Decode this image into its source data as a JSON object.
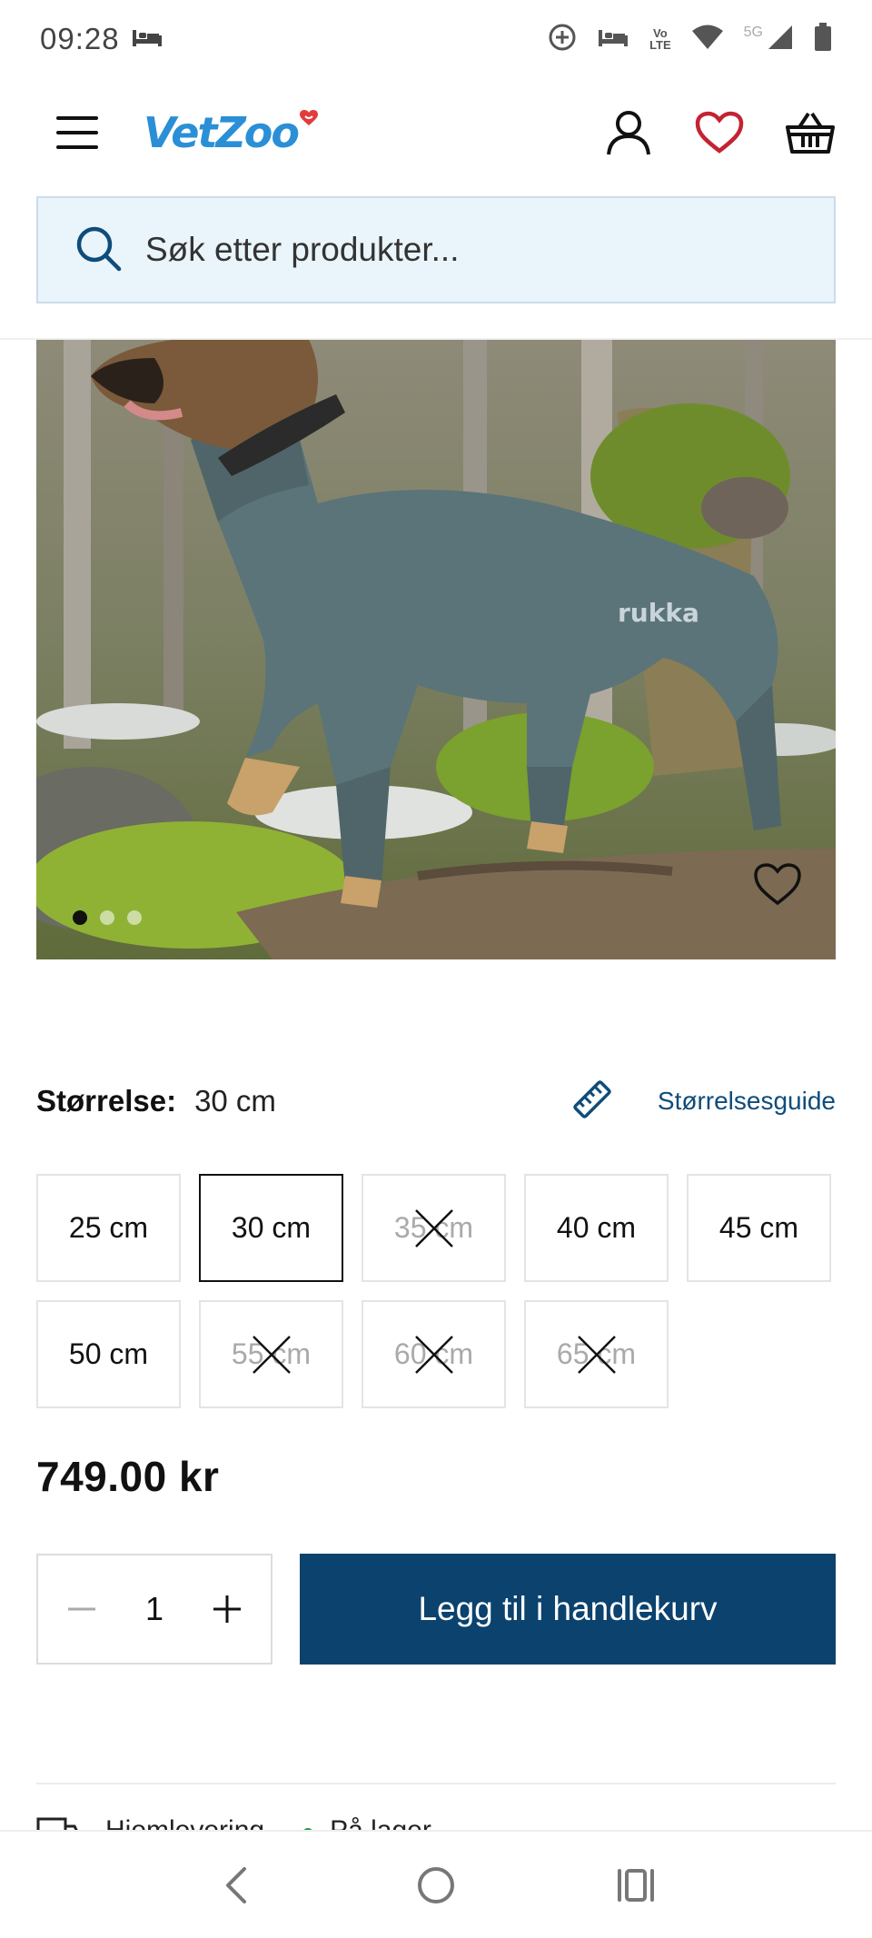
{
  "status_bar": {
    "time": "09:28",
    "network_5g": "5G",
    "lte_top": "Vo",
    "lte_bottom": "LTE",
    "icons": [
      "sleep-icon",
      "data-saver-icon",
      "sleep-icon",
      "volte-icon",
      "wifi-icon",
      "signal-icon",
      "battery-icon"
    ]
  },
  "header": {
    "logo_text": "VetZoo",
    "icons": [
      "menu-icon",
      "user-icon",
      "heart-icon",
      "basket-icon"
    ],
    "colors": {
      "logo": "#2a8fd6",
      "logo_heart": "#e23b3b",
      "wishlist_heart": "#c42333"
    }
  },
  "search": {
    "placeholder": "Søk etter produkter...",
    "value": ""
  },
  "product_image": {
    "alt": "rukka",
    "dots_total": 3,
    "active_dot": 1
  },
  "size_selector": {
    "label": "Størrelse:",
    "selected_value": "30 cm",
    "guide_label": "Størrelsesguide",
    "options": [
      {
        "label": "25 cm",
        "state": "available"
      },
      {
        "label": "30 cm",
        "state": "selected"
      },
      {
        "label": "35 cm",
        "state": "unavailable"
      },
      {
        "label": "40 cm",
        "state": "available"
      },
      {
        "label": "45 cm",
        "state": "available"
      },
      {
        "label": "50 cm",
        "state": "available"
      },
      {
        "label": "55 cm",
        "state": "unavailable"
      },
      {
        "label": "60 cm",
        "state": "unavailable"
      },
      {
        "label": "65 cm",
        "state": "unavailable"
      }
    ]
  },
  "price": "749.00 kr",
  "cart": {
    "quantity": "1",
    "add_label": "Legg til i handlekurv",
    "button_color": "#0b426e"
  },
  "delivery": {
    "left_text": "Hjemlevering",
    "stock_text": "På lager",
    "stock_color": "#1d9a4a"
  },
  "nav_bar": {
    "icons": [
      "back-icon",
      "home-icon",
      "recents-icon"
    ]
  }
}
